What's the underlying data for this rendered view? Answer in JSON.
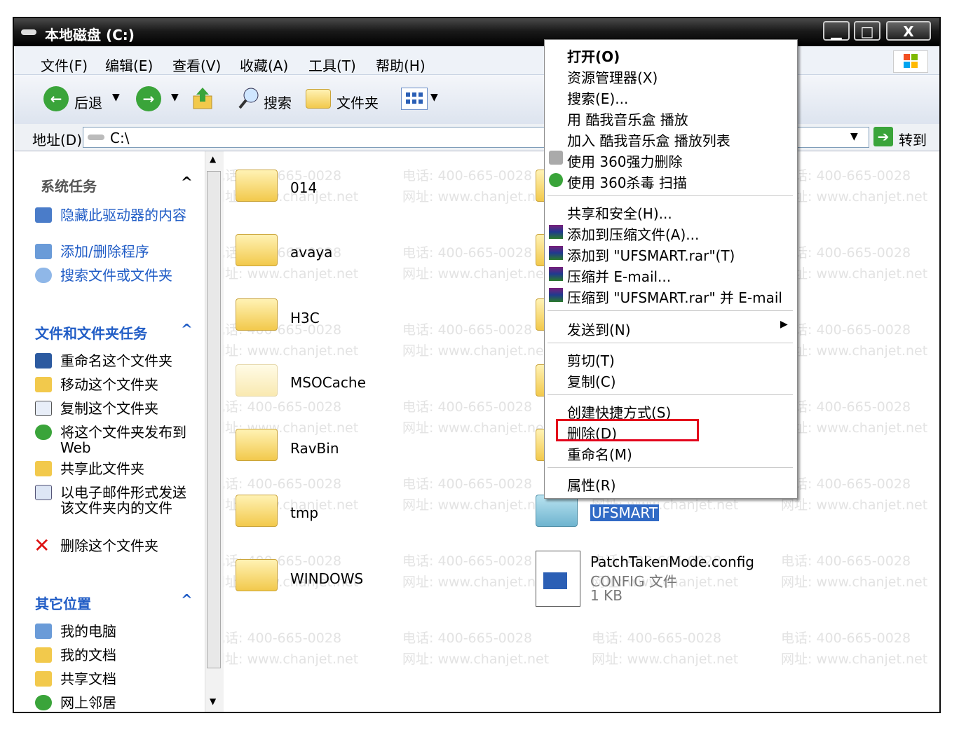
{
  "window": {
    "title": "本地磁盘 (C:)"
  },
  "menu": [
    "文件(F)",
    "编辑(E)",
    "查看(V)",
    "收藏(A)",
    "工具(T)",
    "帮助(H)"
  ],
  "toolbar": {
    "back": "后退",
    "search": "搜索",
    "folders": "文件夹"
  },
  "address": {
    "label": "地址(D)",
    "value": "C:\\",
    "go": "转到"
  },
  "left_pane": {
    "system_tasks": {
      "title": "系统任务",
      "items": [
        "隐藏此驱动器的内容",
        "添加/删除程序",
        "搜索文件或文件夹"
      ]
    },
    "file_tasks": {
      "title": "文件和文件夹任务",
      "items": [
        "重命名这个文件夹",
        "移动这个文件夹",
        "复制这个文件夹",
        "将这个文件夹发布到 Web",
        "共享此文件夹",
        "以电子邮件形式发送该文件夹内的文件",
        "删除这个文件夹"
      ]
    },
    "other_places": {
      "title": "其它位置",
      "items": [
        "我的电脑",
        "我的文档",
        "共享文档",
        "网上邻居"
      ]
    }
  },
  "files": {
    "folders": [
      "014",
      "avaya",
      "H3C",
      "MSOCache",
      "RavBin",
      "tmp",
      "WINDOWS"
    ],
    "selected_folder": "UFSMART",
    "config_file": {
      "name": "PatchTakenMode.config",
      "type": "CONFIG 文件",
      "size": "1 KB"
    }
  },
  "context_menu": {
    "items": [
      "打开(O)",
      "资源管理器(X)",
      "搜索(E)...",
      "用 酷我音乐盒 播放",
      "加入 酷我音乐盒 播放列表",
      "使用 360强力删除",
      "使用 360杀毒 扫描",
      "共享和安全(H)...",
      "添加到压缩文件(A)...",
      "添加到 \"UFSMART.rar\"(T)",
      "压缩并 E-mail...",
      "压缩到 \"UFSMART.rar\" 并 E-mail",
      "发送到(N)",
      "剪切(T)",
      "复制(C)",
      "创建快捷方式(S)",
      "删除(D)",
      "重命名(M)",
      "属性(R)"
    ]
  },
  "watermark": {
    "phone": "电话: 400-665-0028",
    "site": "网址: www.chanjet.net"
  },
  "colors": {
    "accent": "#215dc6",
    "highlight_box": "#e3001b",
    "selection": "#316ac5"
  }
}
